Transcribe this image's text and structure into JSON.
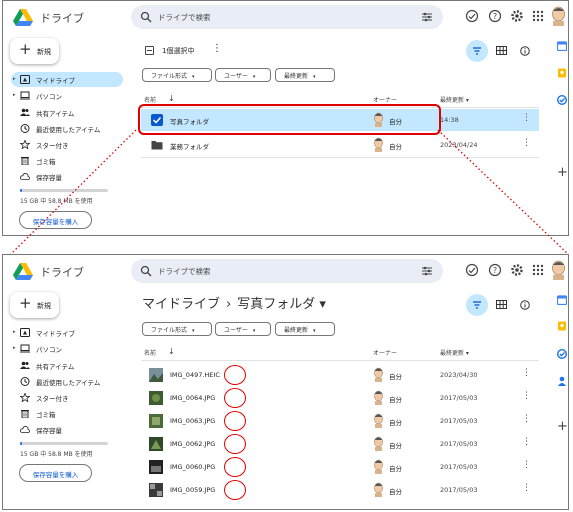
{
  "app_name": "ドライブ",
  "search": {
    "placeholder": "ドライブで検索"
  },
  "new_button": {
    "plus": "+",
    "label": "新規"
  },
  "sidebar": {
    "items": [
      {
        "label": "マイドライブ",
        "icon": "my-drive-icon",
        "caret": "▸"
      },
      {
        "label": "パソコン",
        "icon": "computer-icon",
        "caret": "▸"
      },
      {
        "label": "共有アイテム",
        "icon": "shared-icon",
        "caret": ""
      },
      {
        "label": "最近使用したアイテム",
        "icon": "clock-icon",
        "caret": ""
      },
      {
        "label": "スター付き",
        "icon": "star-icon",
        "caret": ""
      },
      {
        "label": "ゴミ箱",
        "icon": "trash-icon",
        "caret": ""
      },
      {
        "label": "保存容量",
        "icon": "cloud-icon",
        "caret": ""
      }
    ]
  },
  "storage": {
    "text": "15 GB 中 58.8 MB を使用",
    "used_fraction": 0.02,
    "buy_button": "保存容量を購入"
  },
  "top": {
    "selection_count": "1個選択中",
    "more": "⋮",
    "chips": [
      "ファイル形式",
      "ユーザー",
      "最終更新"
    ],
    "chip_arrow": "▾",
    "columns": {
      "name": "名前",
      "name_arrow": "↓",
      "owner": "オーナー",
      "modified": "最終更新 ▾"
    },
    "rows": [
      {
        "name": "写真フォルダ",
        "owner": "自分",
        "date": "14:38",
        "selected": true
      },
      {
        "name": "業務フォルダ",
        "owner": "自分",
        "date": "2023/04/24",
        "selected": false
      }
    ]
  },
  "bottom": {
    "breadcrumb_root": "マイドライブ",
    "breadcrumb_sep": "›",
    "breadcrumb_current": "写真フォルダ ▾",
    "chips": [
      "ファイル形式",
      "ユーザー",
      "最終更新"
    ],
    "chip_arrow": "▾",
    "columns": {
      "name": "名前",
      "name_arrow": "↓",
      "owner": "オーナー",
      "modified": "最終更新 ▾"
    },
    "rows": [
      {
        "name": "IMG_0497.HEIC",
        "owner": "自分",
        "date": "2023/04/30"
      },
      {
        "name": "IMG_0064.JPG",
        "owner": "自分",
        "date": "2017/05/03"
      },
      {
        "name": "IMG_0063.JPG",
        "owner": "自分",
        "date": "2017/05/03"
      },
      {
        "name": "IMG_0062.JPG",
        "owner": "自分",
        "date": "2017/05/03"
      },
      {
        "name": "IMG_0060.JPG",
        "owner": "自分",
        "date": "2017/05/03"
      },
      {
        "name": "IMG_0059.JPG",
        "owner": "自分",
        "date": "2017/05/03"
      }
    ]
  },
  "row_menu": "⋮",
  "rail_plus": "+",
  "colors": {
    "accent": "#0b57d0",
    "selection": "#c2e7ff",
    "search_bg": "#e9eef6",
    "annotation": "#e00000"
  }
}
